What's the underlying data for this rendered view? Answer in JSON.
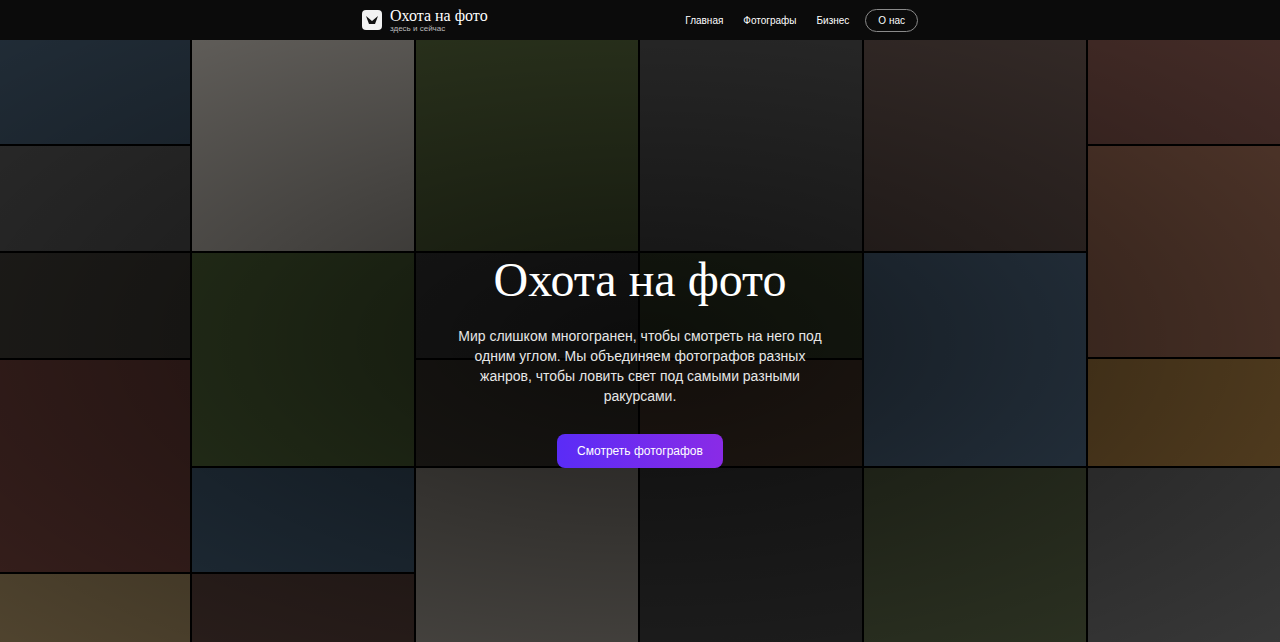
{
  "header": {
    "logo": {
      "title": "Охота на фото",
      "subtitle": "здесь и сейчас"
    },
    "nav": [
      {
        "label": "Главная",
        "selected": false
      },
      {
        "label": "Фотографы",
        "selected": false
      },
      {
        "label": "Бизнес",
        "selected": false
      },
      {
        "label": "О нас",
        "selected": true
      }
    ]
  },
  "hero": {
    "title": "Охота на фото",
    "text": "Мир слишком многогранен, чтобы смотреть на него под одним углом. Мы объединяем фотографов разных жанров, чтобы ловить свет под самыми разными ракурсами.",
    "button": "Смотреть фотографов"
  }
}
